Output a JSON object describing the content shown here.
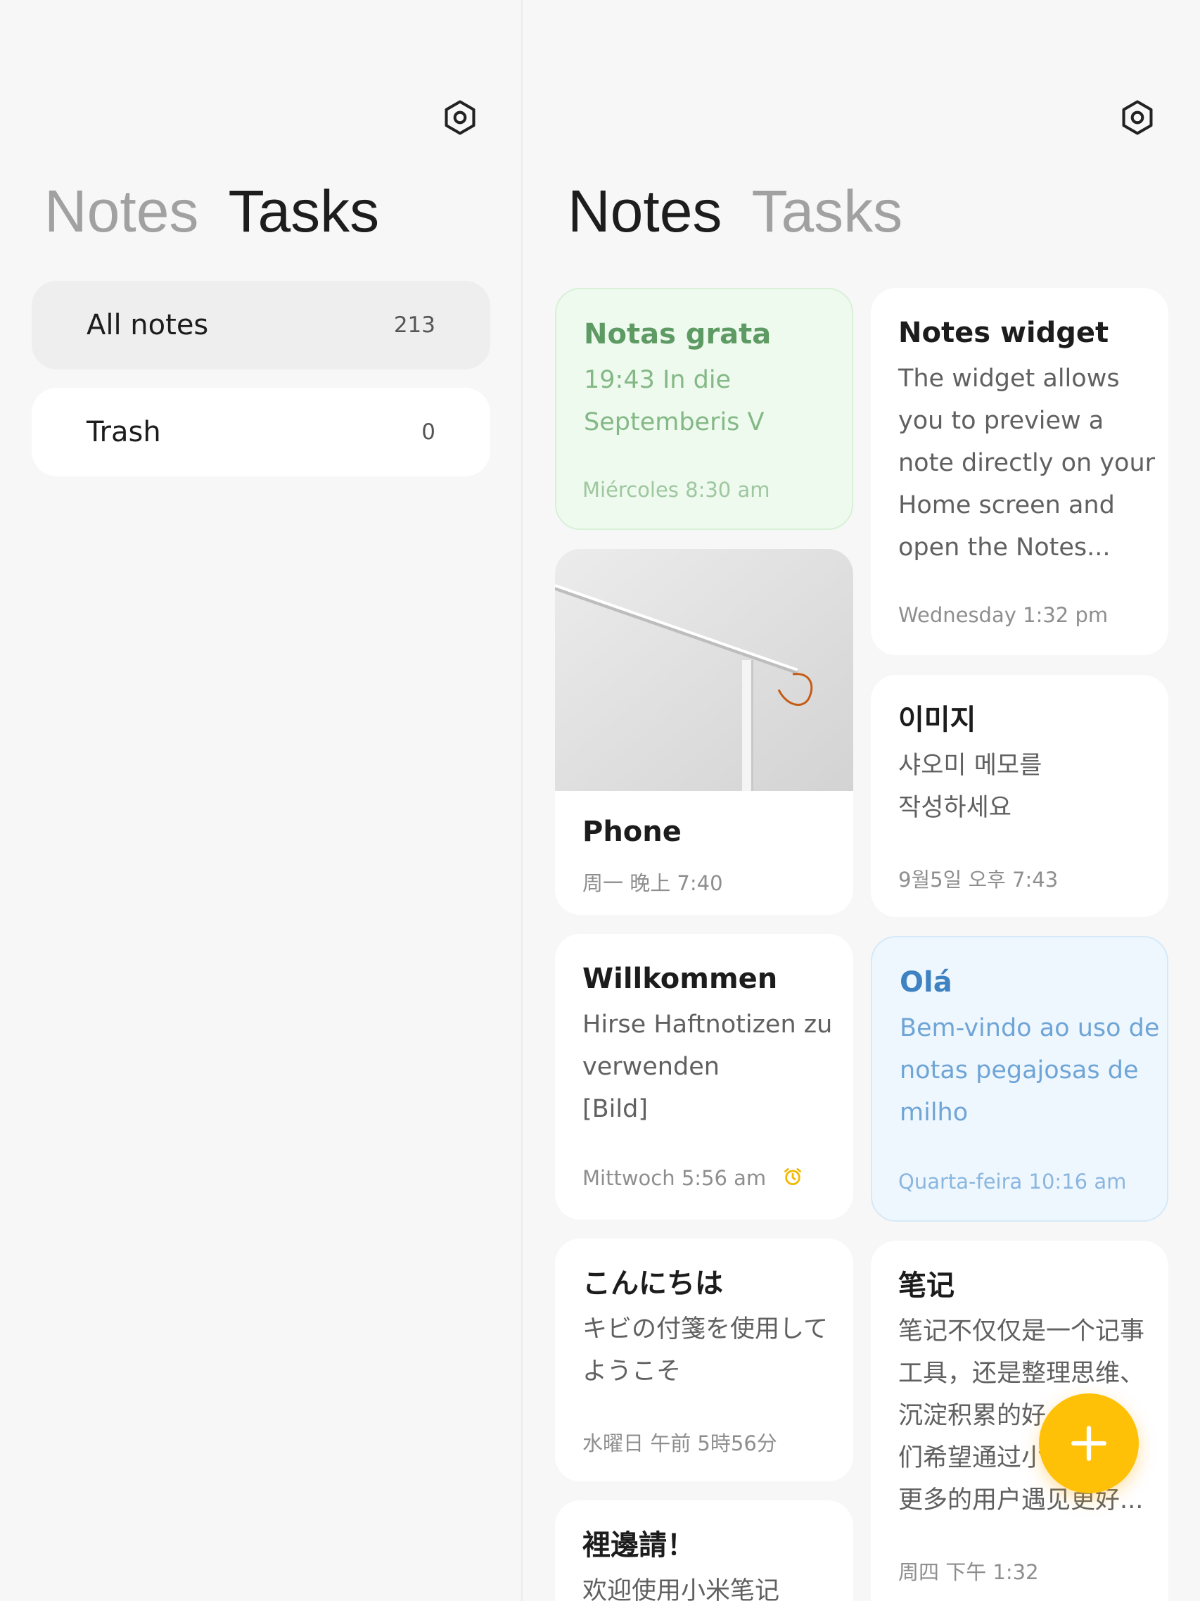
{
  "left_panel": {
    "tabs": {
      "notes": "Notes",
      "tasks": "Tasks"
    },
    "folders": [
      {
        "name": "All notes",
        "count": "213"
      },
      {
        "name": "Trash",
        "count": "0"
      }
    ]
  },
  "right_panel": {
    "tabs": {
      "notes": "Notes",
      "tasks": "Tasks"
    },
    "notes": [
      {
        "title": "Notas grata",
        "body": [
          "19:43 In die",
          "Septemberis V"
        ],
        "date": "Miércoles 8:30 am",
        "color": "#eefaee"
      },
      {
        "title": "Phone",
        "date": "周一 晚上 7:40",
        "image": "desk-lamp-photo"
      },
      {
        "title": "Willkommen",
        "body": [
          "Hirse Haftnotizen zu",
          "verwenden",
          "[Bild]"
        ],
        "date": "Mittwoch 5:56 am",
        "reminder_icon": "alarm-clock-icon"
      },
      {
        "title": "こんにちは",
        "body": [
          "キビの付箋を使用して",
          "ようこそ"
        ],
        "date": "水曜日 午前 5時56分"
      },
      {
        "title": "裡邊請！",
        "body": [
          "欢迎使用小米笔记"
        ]
      },
      {
        "title": "Notes widget",
        "body": [
          "The widget allows",
          "you to preview a",
          "note directly on your",
          "Home screen and",
          "open the Notes..."
        ],
        "date": "Wednesday 1:32 pm"
      },
      {
        "title": "이미지",
        "body": [
          "샤오미 메모를",
          "작성하세요"
        ],
        "date": "9월5일 오후 7:43"
      },
      {
        "title": "Olá",
        "body": [
          "Bem-vindo ao uso de",
          "notas pegajosas de",
          "milho"
        ],
        "date": "Quarta-feira 10:16 am",
        "color": "#eff7fe"
      },
      {
        "title": "笔记",
        "body": [
          "笔记不仅仅是一个记事",
          "工具，还是整理思维、",
          "沉淀积累的好",
          "们希望通过小",
          "更多的用户遇见更好..."
        ],
        "date": "周四 下午 1:32"
      }
    ]
  },
  "fab": {
    "icon": "plus-icon",
    "color": "#ffc107"
  },
  "settings_icon": "settings-icon"
}
